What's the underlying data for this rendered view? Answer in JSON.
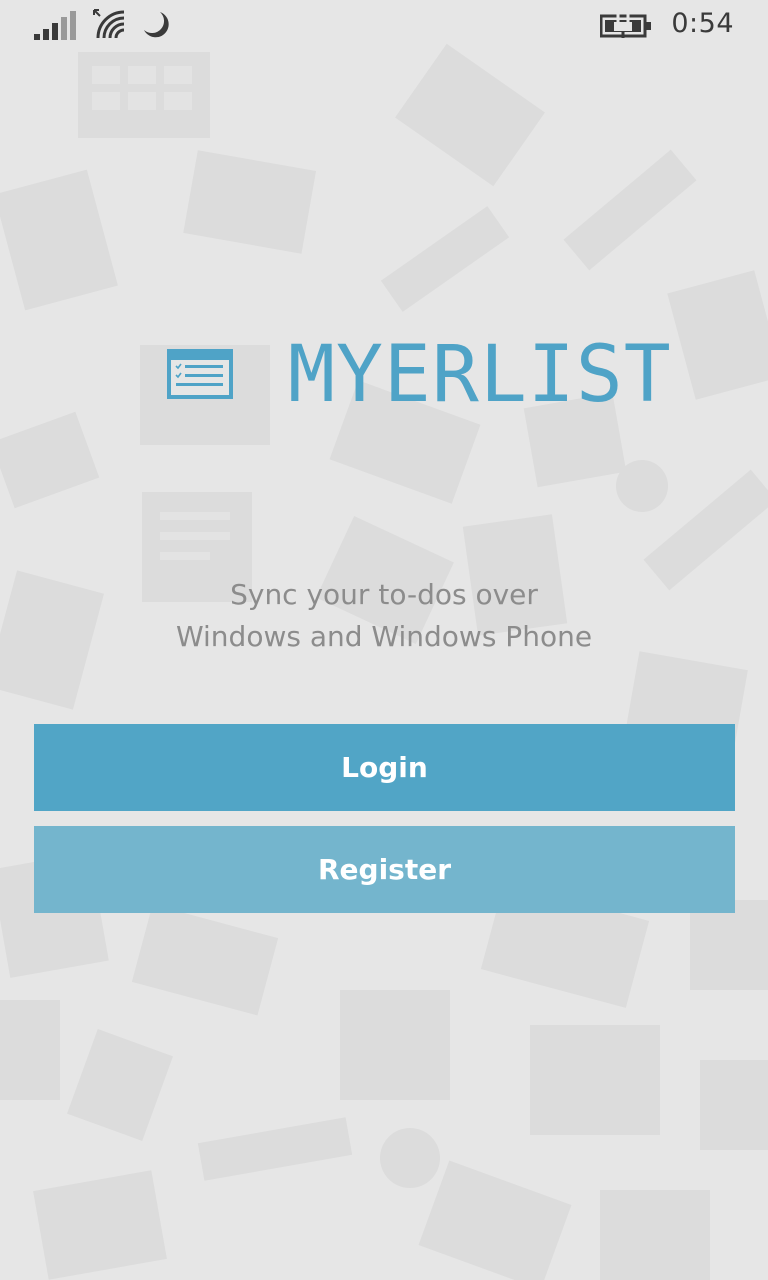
{
  "status_bar": {
    "time": "0:54",
    "icons": [
      "signal-strength-icon",
      "wifi-icon",
      "quiet-hours-moon-icon",
      "battery-charging-icon"
    ]
  },
  "app": {
    "title": "MYERLIST",
    "logo_icon": "checklist-icon",
    "tagline_line1": "Sync your to-dos over",
    "tagline_line2": "Windows and Windows Phone"
  },
  "actions": {
    "login_label": "Login",
    "register_label": "Register"
  },
  "colors": {
    "accent": "#4fa3c7",
    "login_button": "#51a5c6",
    "register_button": "#74b5cd",
    "background": "#e6e6e6"
  }
}
